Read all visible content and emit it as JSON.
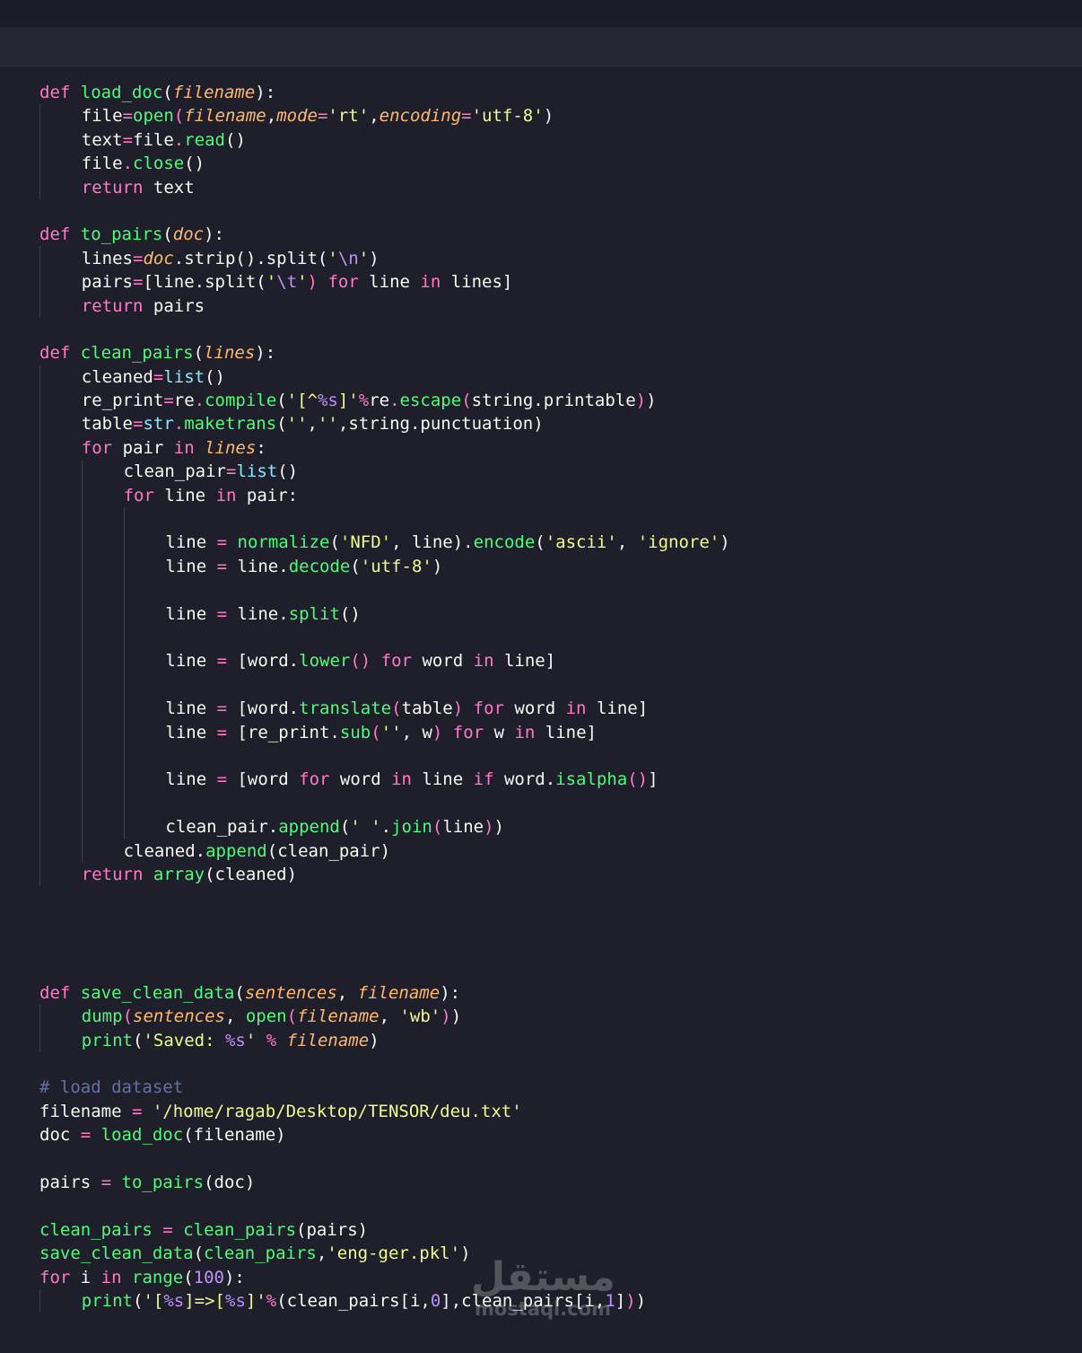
{
  "colors": {
    "keyword": "#ff79c6",
    "function": "#50fa7b",
    "string": "#f1fa8c",
    "param": "#ffb86c",
    "builtin": "#8be9fd",
    "number": "#bd93f9",
    "comment": "#6272a4",
    "text": "#f8f8f2"
  },
  "lines": [
    {
      "indent": 0,
      "tokens": [
        [
          "def",
          "k"
        ],
        [
          " ",
          "t"
        ],
        [
          "load_doc",
          "f"
        ],
        [
          "(",
          "t"
        ],
        [
          "filename",
          "p"
        ],
        [
          "):",
          "t"
        ]
      ]
    },
    {
      "indent": 1,
      "tokens": [
        [
          "file",
          "t"
        ],
        [
          "=",
          "k"
        ],
        [
          "open",
          "f"
        ],
        [
          "(",
          "k"
        ],
        [
          "filename",
          "p"
        ],
        [
          ",",
          "t"
        ],
        [
          "mode",
          "p"
        ],
        [
          "=",
          "k"
        ],
        [
          "'rt'",
          "s"
        ],
        [
          ",",
          "t"
        ],
        [
          "encoding",
          "p"
        ],
        [
          "=",
          "k"
        ],
        [
          "'utf-8'",
          "s"
        ],
        [
          ")",
          "t"
        ]
      ]
    },
    {
      "indent": 1,
      "tokens": [
        [
          "text",
          "t"
        ],
        [
          "=",
          "k"
        ],
        [
          "file",
          "t"
        ],
        [
          ".",
          "k"
        ],
        [
          "read",
          "f"
        ],
        [
          "()",
          "t"
        ]
      ]
    },
    {
      "indent": 1,
      "tokens": [
        [
          "file",
          "t"
        ],
        [
          ".",
          "k"
        ],
        [
          "close",
          "f"
        ],
        [
          "()",
          "t"
        ]
      ]
    },
    {
      "indent": 1,
      "tokens": [
        [
          "return",
          "k"
        ],
        [
          " text",
          "t"
        ]
      ]
    },
    {
      "indent": 0,
      "tokens": []
    },
    {
      "indent": 0,
      "tokens": [
        [
          "def",
          "k"
        ],
        [
          " ",
          "t"
        ],
        [
          "to_pairs",
          "f"
        ],
        [
          "(",
          "t"
        ],
        [
          "doc",
          "p"
        ],
        [
          "):",
          "t"
        ]
      ]
    },
    {
      "indent": 1,
      "tokens": [
        [
          "lines",
          "t"
        ],
        [
          "=",
          "k"
        ],
        [
          "doc",
          "p"
        ],
        [
          ".strip().split(",
          "t"
        ],
        [
          "'",
          "s"
        ],
        [
          "\\n",
          "n"
        ],
        [
          "'",
          "s"
        ],
        [
          ")",
          "t"
        ]
      ]
    },
    {
      "indent": 1,
      "tokens": [
        [
          "pairs",
          "t"
        ],
        [
          "=",
          "k"
        ],
        [
          "[line.split(",
          "t"
        ],
        [
          "'",
          "s"
        ],
        [
          "\\t",
          "n"
        ],
        [
          "'",
          "s"
        ],
        [
          ")",
          "k"
        ],
        [
          " ",
          "t"
        ],
        [
          "for",
          "k"
        ],
        [
          " line ",
          "t"
        ],
        [
          "in",
          "k"
        ],
        [
          " lines]",
          "t"
        ]
      ]
    },
    {
      "indent": 1,
      "tokens": [
        [
          "return",
          "k"
        ],
        [
          " pairs",
          "t"
        ]
      ]
    },
    {
      "indent": 0,
      "tokens": []
    },
    {
      "indent": 0,
      "tokens": [
        [
          "def",
          "k"
        ],
        [
          " ",
          "t"
        ],
        [
          "clean_pairs",
          "f"
        ],
        [
          "(",
          "t"
        ],
        [
          "lines",
          "p"
        ],
        [
          "):",
          "t"
        ]
      ]
    },
    {
      "indent": 1,
      "tokens": [
        [
          "cleaned",
          "t"
        ],
        [
          "=",
          "k"
        ],
        [
          "list",
          "b"
        ],
        [
          "()",
          "t"
        ]
      ]
    },
    {
      "indent": 1,
      "tokens": [
        [
          "re_print",
          "t"
        ],
        [
          "=",
          "k"
        ],
        [
          "re",
          "t"
        ],
        [
          ".",
          "k"
        ],
        [
          "compile",
          "f"
        ],
        [
          "(",
          "t"
        ],
        [
          "'[^",
          "s"
        ],
        [
          "%s",
          "n"
        ],
        [
          "]'",
          "s"
        ],
        [
          "%",
          "k"
        ],
        [
          "re",
          "t"
        ],
        [
          ".",
          "k"
        ],
        [
          "escape",
          "f"
        ],
        [
          "(",
          "k"
        ],
        [
          "string.printable",
          "t"
        ],
        [
          ")",
          "k"
        ],
        [
          ")",
          "t"
        ]
      ]
    },
    {
      "indent": 1,
      "tokens": [
        [
          "table",
          "t"
        ],
        [
          "=",
          "k"
        ],
        [
          "str",
          "b"
        ],
        [
          ".",
          "k"
        ],
        [
          "maketrans",
          "f"
        ],
        [
          "(",
          "t"
        ],
        [
          "''",
          "s"
        ],
        [
          ",",
          "t"
        ],
        [
          "''",
          "s"
        ],
        [
          ",string.punctuation)",
          "t"
        ]
      ]
    },
    {
      "indent": 1,
      "tokens": [
        [
          "for",
          "k"
        ],
        [
          " pair ",
          "t"
        ],
        [
          "in",
          "k"
        ],
        [
          " ",
          "t"
        ],
        [
          "lines",
          "p"
        ],
        [
          ":",
          "t"
        ]
      ]
    },
    {
      "indent": 2,
      "tokens": [
        [
          "clean_pair",
          "t"
        ],
        [
          "=",
          "k"
        ],
        [
          "list",
          "b"
        ],
        [
          "()",
          "t"
        ]
      ]
    },
    {
      "indent": 2,
      "tokens": [
        [
          "for",
          "k"
        ],
        [
          " line ",
          "t"
        ],
        [
          "in",
          "k"
        ],
        [
          " pair:",
          "t"
        ]
      ]
    },
    {
      "indent": 3,
      "tokens": []
    },
    {
      "indent": 3,
      "tokens": [
        [
          "line ",
          "t"
        ],
        [
          "=",
          "k"
        ],
        [
          " ",
          "t"
        ],
        [
          "normalize",
          "f"
        ],
        [
          "(",
          "t"
        ],
        [
          "'NFD'",
          "s"
        ],
        [
          ", line).",
          "t"
        ],
        [
          "encode",
          "f"
        ],
        [
          "(",
          "t"
        ],
        [
          "'ascii'",
          "s"
        ],
        [
          ", ",
          "t"
        ],
        [
          "'ignore'",
          "s"
        ],
        [
          ")",
          "t"
        ]
      ]
    },
    {
      "indent": 3,
      "tokens": [
        [
          "line ",
          "t"
        ],
        [
          "=",
          "k"
        ],
        [
          " line.",
          "t"
        ],
        [
          "decode",
          "f"
        ],
        [
          "(",
          "t"
        ],
        [
          "'utf-8'",
          "s"
        ],
        [
          ")",
          "t"
        ]
      ]
    },
    {
      "indent": 3,
      "tokens": []
    },
    {
      "indent": 3,
      "tokens": [
        [
          "line ",
          "t"
        ],
        [
          "=",
          "k"
        ],
        [
          " line.",
          "t"
        ],
        [
          "split",
          "f"
        ],
        [
          "()",
          "t"
        ]
      ]
    },
    {
      "indent": 3,
      "tokens": []
    },
    {
      "indent": 3,
      "tokens": [
        [
          "line ",
          "t"
        ],
        [
          "=",
          "k"
        ],
        [
          " [word.",
          "t"
        ],
        [
          "lower",
          "f"
        ],
        [
          "()",
          "k"
        ],
        [
          " ",
          "t"
        ],
        [
          "for",
          "k"
        ],
        [
          " word ",
          "t"
        ],
        [
          "in",
          "k"
        ],
        [
          " line]",
          "t"
        ]
      ]
    },
    {
      "indent": 3,
      "tokens": []
    },
    {
      "indent": 3,
      "tokens": [
        [
          "line ",
          "t"
        ],
        [
          "=",
          "k"
        ],
        [
          " [word.",
          "t"
        ],
        [
          "translate",
          "f"
        ],
        [
          "(",
          "k"
        ],
        [
          "table",
          "t"
        ],
        [
          ")",
          "k"
        ],
        [
          " ",
          "t"
        ],
        [
          "for",
          "k"
        ],
        [
          " word ",
          "t"
        ],
        [
          "in",
          "k"
        ],
        [
          " line]",
          "t"
        ]
      ]
    },
    {
      "indent": 3,
      "tokens": [
        [
          "line ",
          "t"
        ],
        [
          "=",
          "k"
        ],
        [
          " [re_print.",
          "t"
        ],
        [
          "sub",
          "f"
        ],
        [
          "(",
          "k"
        ],
        [
          "''",
          "s"
        ],
        [
          ", w",
          "t"
        ],
        [
          ")",
          "k"
        ],
        [
          " ",
          "t"
        ],
        [
          "for",
          "k"
        ],
        [
          " w ",
          "t"
        ],
        [
          "in",
          "k"
        ],
        [
          " line]",
          "t"
        ]
      ]
    },
    {
      "indent": 3,
      "tokens": []
    },
    {
      "indent": 3,
      "tokens": [
        [
          "line ",
          "t"
        ],
        [
          "=",
          "k"
        ],
        [
          " [word ",
          "t"
        ],
        [
          "for",
          "k"
        ],
        [
          " word ",
          "t"
        ],
        [
          "in",
          "k"
        ],
        [
          " line ",
          "t"
        ],
        [
          "if",
          "k"
        ],
        [
          " word.",
          "t"
        ],
        [
          "isalpha",
          "f"
        ],
        [
          "()",
          "k"
        ],
        [
          "]",
          "t"
        ]
      ]
    },
    {
      "indent": 3,
      "tokens": []
    },
    {
      "indent": 3,
      "tokens": [
        [
          "clean_pair.",
          "t"
        ],
        [
          "append",
          "f"
        ],
        [
          "(",
          "t"
        ],
        [
          "' '",
          "s"
        ],
        [
          ".",
          "t"
        ],
        [
          "join",
          "f"
        ],
        [
          "(",
          "k"
        ],
        [
          "line",
          "t"
        ],
        [
          ")",
          "k"
        ],
        [
          ")",
          "t"
        ]
      ]
    },
    {
      "indent": 2,
      "tokens": [
        [
          "cleaned.",
          "t"
        ],
        [
          "append",
          "f"
        ],
        [
          "(clean_pair)",
          "t"
        ]
      ]
    },
    {
      "indent": 1,
      "tokens": [
        [
          "return",
          "k"
        ],
        [
          " ",
          "t"
        ],
        [
          "array",
          "f"
        ],
        [
          "(cleaned)",
          "t"
        ]
      ]
    },
    {
      "indent": 0,
      "tokens": []
    },
    {
      "indent": 0,
      "tokens": []
    },
    {
      "indent": 0,
      "tokens": []
    },
    {
      "indent": 0,
      "tokens": []
    },
    {
      "indent": 0,
      "tokens": [
        [
          "def",
          "k"
        ],
        [
          " ",
          "t"
        ],
        [
          "save_clean_data",
          "f"
        ],
        [
          "(",
          "t"
        ],
        [
          "sentences",
          "p"
        ],
        [
          ", ",
          "t"
        ],
        [
          "filename",
          "p"
        ],
        [
          "):",
          "t"
        ]
      ]
    },
    {
      "indent": 1,
      "tokens": [
        [
          "dump",
          "f"
        ],
        [
          "(",
          "k"
        ],
        [
          "sentences",
          "p"
        ],
        [
          ", ",
          "t"
        ],
        [
          "open",
          "f"
        ],
        [
          "(",
          "k"
        ],
        [
          "filename",
          "p"
        ],
        [
          ", ",
          "t"
        ],
        [
          "'wb'",
          "s"
        ],
        [
          ")",
          "k"
        ],
        [
          ")",
          "t"
        ]
      ]
    },
    {
      "indent": 1,
      "tokens": [
        [
          "print",
          "f"
        ],
        [
          "(",
          "t"
        ],
        [
          "'Saved: ",
          "s"
        ],
        [
          "%s",
          "n"
        ],
        [
          "'",
          "s"
        ],
        [
          " ",
          "t"
        ],
        [
          "%",
          "k"
        ],
        [
          " ",
          "t"
        ],
        [
          "filename",
          "p"
        ],
        [
          ")",
          "t"
        ]
      ]
    },
    {
      "indent": 0,
      "tokens": []
    },
    {
      "indent": 0,
      "tokens": [
        [
          "# load dataset",
          "c"
        ]
      ]
    },
    {
      "indent": 0,
      "tokens": [
        [
          "filename ",
          "t"
        ],
        [
          "=",
          "k"
        ],
        [
          " ",
          "t"
        ],
        [
          "'/home/ragab/Desktop/TENSOR/deu.txt'",
          "s"
        ]
      ]
    },
    {
      "indent": 0,
      "tokens": [
        [
          "doc ",
          "t"
        ],
        [
          "=",
          "k"
        ],
        [
          " ",
          "t"
        ],
        [
          "load_doc",
          "f"
        ],
        [
          "(filename)",
          "t"
        ]
      ]
    },
    {
      "indent": 0,
      "tokens": []
    },
    {
      "indent": 0,
      "tokens": [
        [
          "pairs ",
          "t"
        ],
        [
          "=",
          "k"
        ],
        [
          " ",
          "t"
        ],
        [
          "to_pairs",
          "f"
        ],
        [
          "(doc)",
          "t"
        ]
      ]
    },
    {
      "indent": 0,
      "tokens": []
    },
    {
      "indent": 0,
      "tokens": [
        [
          "clean_pairs",
          "f"
        ],
        [
          " ",
          "t"
        ],
        [
          "=",
          "k"
        ],
        [
          " ",
          "t"
        ],
        [
          "clean_pairs",
          "f"
        ],
        [
          "(pairs)",
          "t"
        ]
      ]
    },
    {
      "indent": 0,
      "tokens": [
        [
          "save_clean_data",
          "f"
        ],
        [
          "(",
          "t"
        ],
        [
          "clean_pairs",
          "f"
        ],
        [
          ",",
          "t"
        ],
        [
          "'eng-ger.pkl'",
          "s"
        ],
        [
          ")",
          "t"
        ]
      ]
    },
    {
      "indent": 0,
      "tokens": [
        [
          "for",
          "k"
        ],
        [
          " i ",
          "t"
        ],
        [
          "in",
          "k"
        ],
        [
          " ",
          "t"
        ],
        [
          "range",
          "f"
        ],
        [
          "(",
          "t"
        ],
        [
          "100",
          "n"
        ],
        [
          "):",
          "t"
        ]
      ]
    },
    {
      "indent": 1,
      "tokens": [
        [
          "print",
          "f"
        ],
        [
          "(",
          "t"
        ],
        [
          "'[",
          "s"
        ],
        [
          "%s",
          "n"
        ],
        [
          "]=>[",
          "s"
        ],
        [
          "%s",
          "n"
        ],
        [
          "]'",
          "s"
        ],
        [
          "%",
          "k"
        ],
        [
          "(clean_pairs[i,",
          "t"
        ],
        [
          "0",
          "n"
        ],
        [
          "],clean_pairs[i,",
          "t"
        ],
        [
          "1",
          "n"
        ],
        [
          "]",
          "t"
        ],
        [
          ")",
          "k"
        ],
        [
          ")",
          "t"
        ]
      ]
    }
  ],
  "watermark": {
    "arabic": "مستقل",
    "latin": "mostaql.com"
  }
}
